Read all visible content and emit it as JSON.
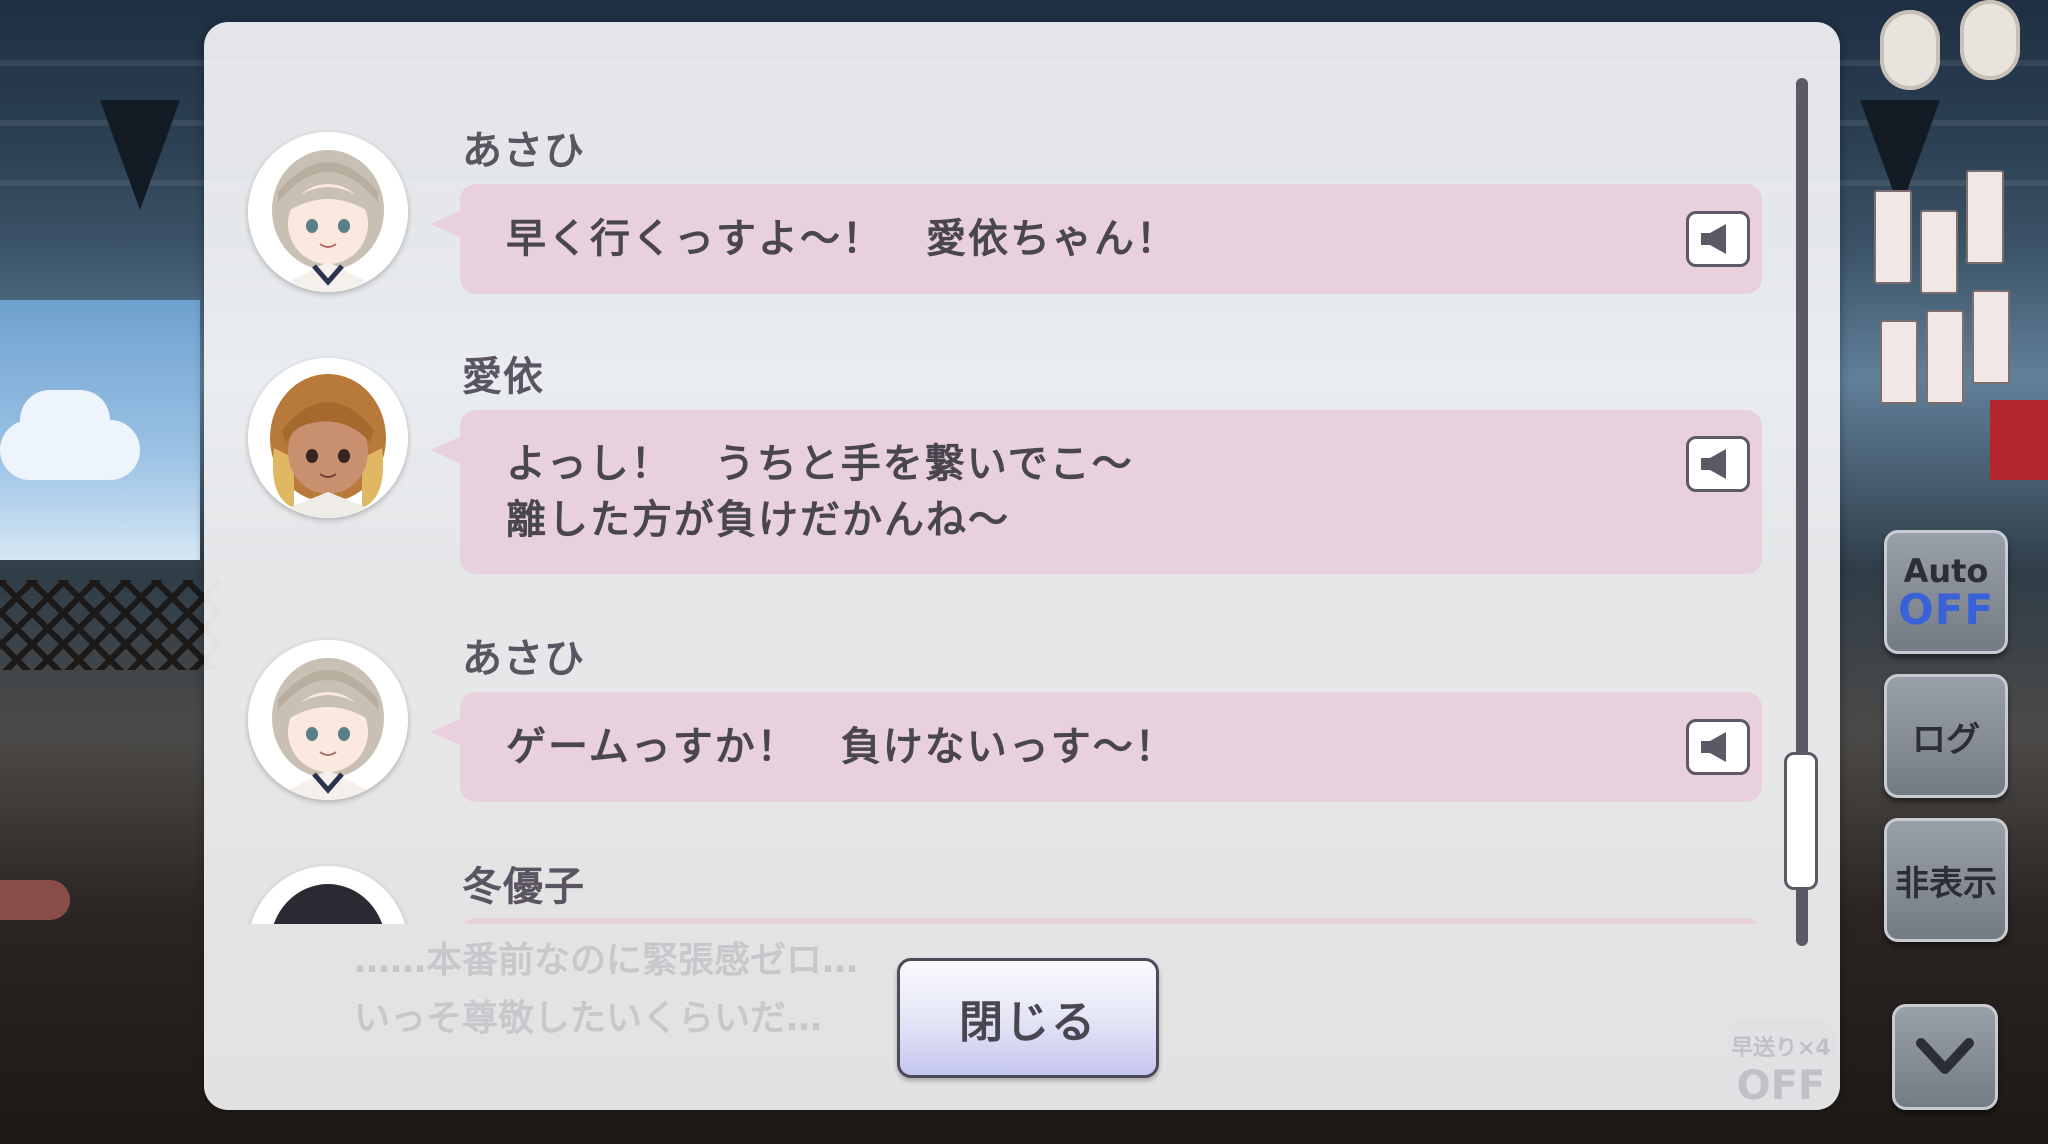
{
  "dialog": {
    "entries": [
      {
        "speaker": "あさひ",
        "lines": [
          "早く行くっすよ〜！　愛依ちゃん！"
        ]
      },
      {
        "speaker": "愛依",
        "lines": [
          "よっし！　うちと手を繋いでこ〜",
          "離した方が負けだかんね〜"
        ]
      },
      {
        "speaker": "あさひ",
        "lines": [
          "ゲームっすか！　負けないっす〜！"
        ]
      },
      {
        "speaker": "冬優子",
        "lines": []
      }
    ],
    "close_label": "閉じる"
  },
  "background_text": {
    "lines": [
      "……本番前なのに緊張感ゼロ…",
      "いっそ尊敬したいくらいだ…"
    ],
    "fast_forward_label": "早送り×4",
    "fast_forward_state": "OFF"
  },
  "controls": {
    "auto_label": "Auto",
    "auto_state": "OFF",
    "log_label": "ログ",
    "hide_label": "非表示"
  },
  "colors": {
    "bubble": "#e8d1dc",
    "auto_off": "#3a62d8",
    "text": "#4a4650"
  }
}
